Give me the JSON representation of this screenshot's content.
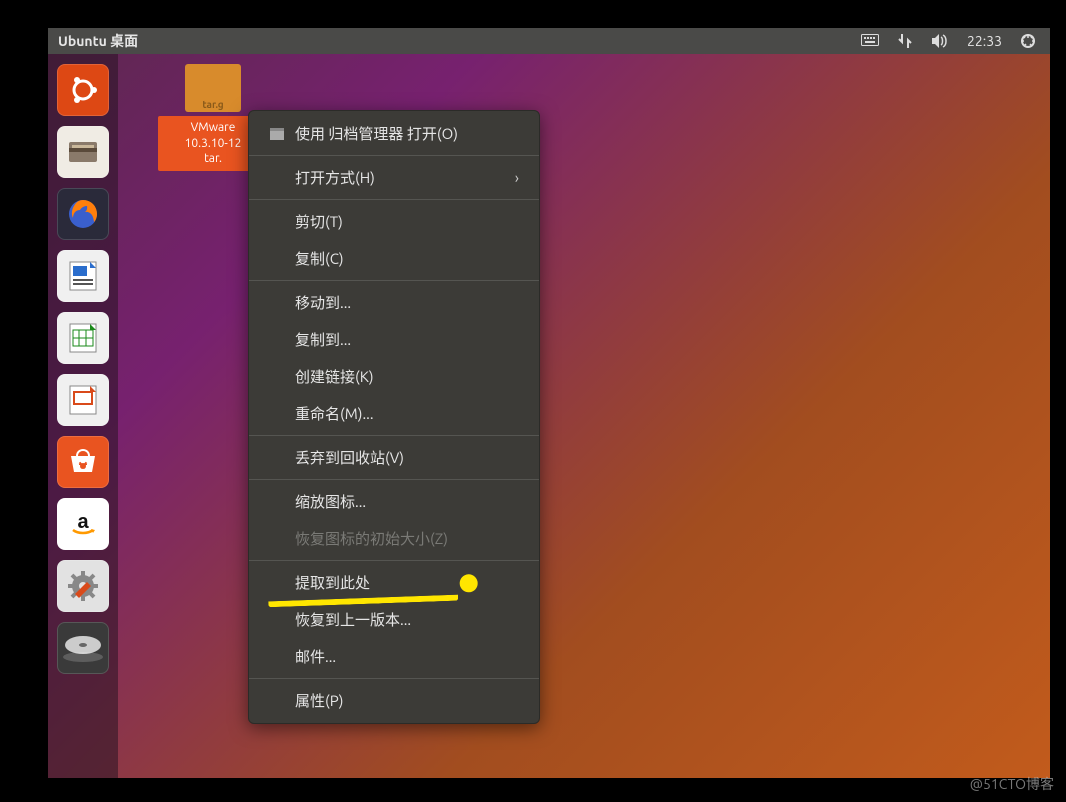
{
  "topbar": {
    "title": "Ubuntu 桌面",
    "clock": "22:33"
  },
  "file": {
    "icon_tag": "tar.g",
    "line1": "VMware",
    "line2": "10.3.10-12",
    "line3": "tar."
  },
  "menu": {
    "open_with_archive": "使用 归档管理器 打开(O)",
    "open_with": "打开方式(H)",
    "cut": "剪切(T)",
    "copy": "复制(C)",
    "move_to": "移动到...",
    "copy_to": "复制到...",
    "create_link": "创建链接(K)",
    "rename": "重命名(M)...",
    "trash": "丢弃到回收站(V)",
    "zoom": "缩放图标...",
    "restore_size": "恢复图标的初始大小(Z)",
    "extract_here": "提取到此处",
    "restore_prev": "恢复到上一版本...",
    "mail": "邮件...",
    "properties": "属性(P)"
  },
  "launcher": [
    "ubuntu",
    "files",
    "firefox",
    "writer",
    "calc",
    "impress",
    "software",
    "amazon",
    "settings",
    "disc"
  ],
  "watermark": "@51CTO博客"
}
